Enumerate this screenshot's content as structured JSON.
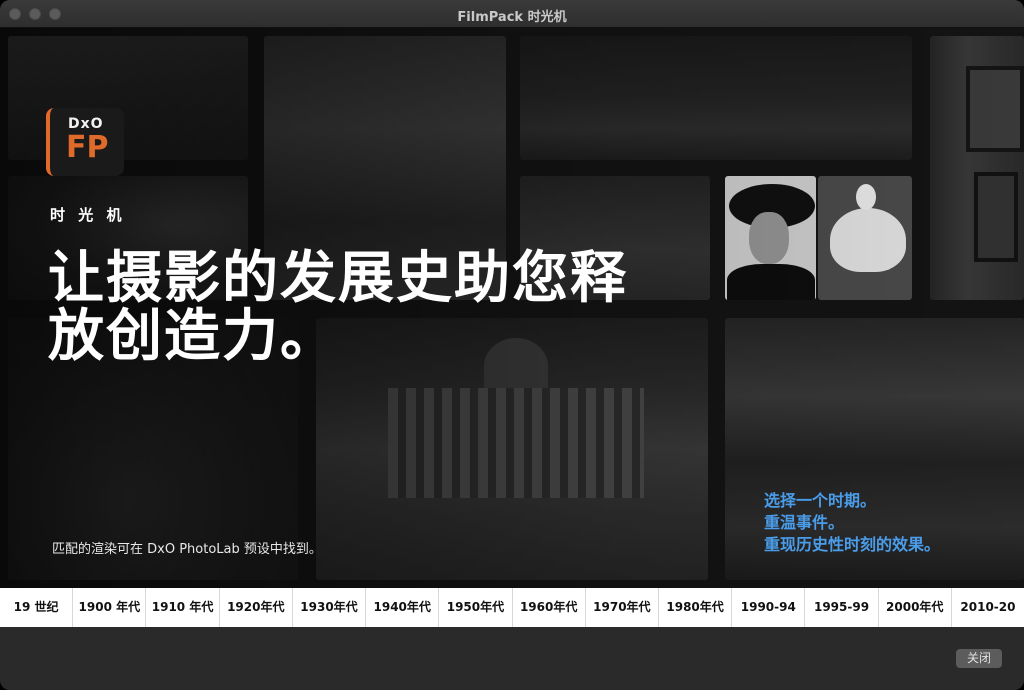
{
  "window": {
    "title": "FilmPack 时光机"
  },
  "logo": {
    "brand": "DxO",
    "product": "FP",
    "accent": "#e06a2a"
  },
  "hero": {
    "kicker": "时 光 机",
    "headline_line1": "让摄影的发展史助您释",
    "headline_line2": "放创造力。",
    "footnote": "匹配的渲染可在 DxO PhotoLab 预设中找到。",
    "tagline": [
      "选择一个时期。",
      "重温事件。",
      "重现历史性时刻的效果。"
    ],
    "tagline_color": "#4a9dea"
  },
  "decades": [
    "19 世纪",
    "1900 年代",
    "1910 年代",
    "1920年代",
    "1930年代",
    "1940年代",
    "1950年代",
    "1960年代",
    "1970年代",
    "1980年代",
    "1990-94",
    "1995-99",
    "2000年代",
    "2010-20"
  ],
  "footer": {
    "close_label": "关闭"
  }
}
